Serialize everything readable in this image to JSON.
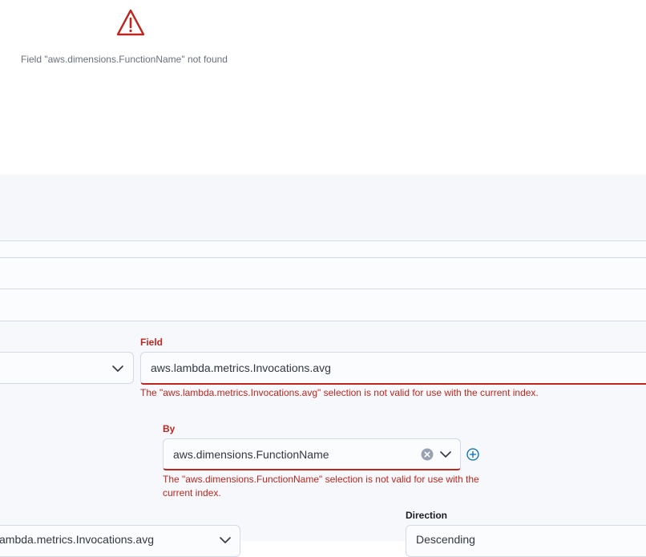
{
  "error": {
    "icon": "warning-icon",
    "message": "Field \"aws.dimensions.FunctionName\" not found"
  },
  "metric": {
    "aggregation_value": "",
    "field_label": "Field",
    "field_value": "aws.lambda.metrics.Invocations.avg",
    "field_error": "The \"aws.lambda.metrics.Invocations.avg\" selection is not valid for use with the current index."
  },
  "group_by": {
    "label": "By",
    "value": "aws.dimensions.FunctionName",
    "error": "The \"aws.dimensions.FunctionName\" selection is not valid for use with the current index."
  },
  "order": {
    "field_value": "ambda.metrics.Invocations.avg",
    "direction_label": "Direction",
    "direction_value": "Descending"
  },
  "colors": {
    "danger": "#bd271e",
    "primary": "#006bb8",
    "background": "#f7f8fc"
  }
}
